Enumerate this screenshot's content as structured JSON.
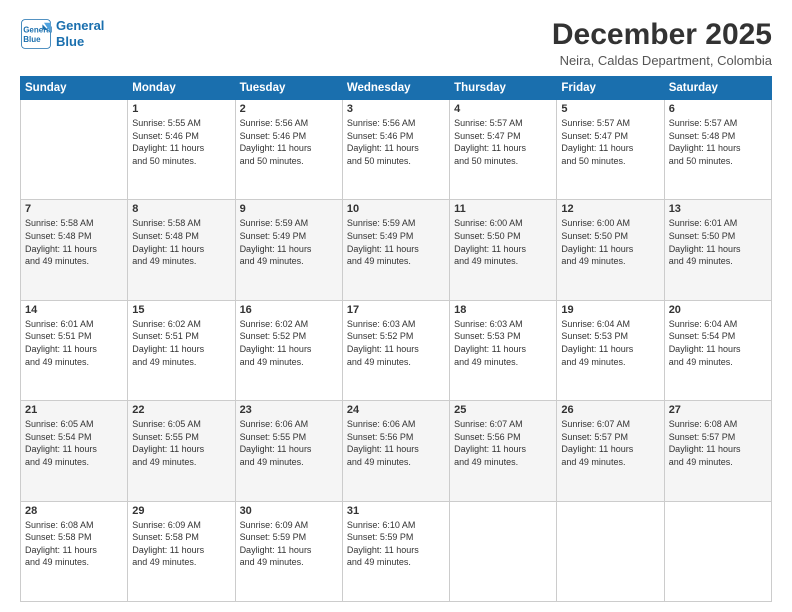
{
  "header": {
    "logo_line1": "General",
    "logo_line2": "Blue",
    "title": "December 2025",
    "subtitle": "Neira, Caldas Department, Colombia"
  },
  "days_of_week": [
    "Sunday",
    "Monday",
    "Tuesday",
    "Wednesday",
    "Thursday",
    "Friday",
    "Saturday"
  ],
  "weeks": [
    [
      {
        "day": "",
        "info": ""
      },
      {
        "day": "1",
        "info": "Sunrise: 5:55 AM\nSunset: 5:46 PM\nDaylight: 11 hours\nand 50 minutes."
      },
      {
        "day": "2",
        "info": "Sunrise: 5:56 AM\nSunset: 5:46 PM\nDaylight: 11 hours\nand 50 minutes."
      },
      {
        "day": "3",
        "info": "Sunrise: 5:56 AM\nSunset: 5:46 PM\nDaylight: 11 hours\nand 50 minutes."
      },
      {
        "day": "4",
        "info": "Sunrise: 5:57 AM\nSunset: 5:47 PM\nDaylight: 11 hours\nand 50 minutes."
      },
      {
        "day": "5",
        "info": "Sunrise: 5:57 AM\nSunset: 5:47 PM\nDaylight: 11 hours\nand 50 minutes."
      },
      {
        "day": "6",
        "info": "Sunrise: 5:57 AM\nSunset: 5:48 PM\nDaylight: 11 hours\nand 50 minutes."
      }
    ],
    [
      {
        "day": "7",
        "info": "Sunrise: 5:58 AM\nSunset: 5:48 PM\nDaylight: 11 hours\nand 49 minutes."
      },
      {
        "day": "8",
        "info": "Sunrise: 5:58 AM\nSunset: 5:48 PM\nDaylight: 11 hours\nand 49 minutes."
      },
      {
        "day": "9",
        "info": "Sunrise: 5:59 AM\nSunset: 5:49 PM\nDaylight: 11 hours\nand 49 minutes."
      },
      {
        "day": "10",
        "info": "Sunrise: 5:59 AM\nSunset: 5:49 PM\nDaylight: 11 hours\nand 49 minutes."
      },
      {
        "day": "11",
        "info": "Sunrise: 6:00 AM\nSunset: 5:50 PM\nDaylight: 11 hours\nand 49 minutes."
      },
      {
        "day": "12",
        "info": "Sunrise: 6:00 AM\nSunset: 5:50 PM\nDaylight: 11 hours\nand 49 minutes."
      },
      {
        "day": "13",
        "info": "Sunrise: 6:01 AM\nSunset: 5:50 PM\nDaylight: 11 hours\nand 49 minutes."
      }
    ],
    [
      {
        "day": "14",
        "info": "Sunrise: 6:01 AM\nSunset: 5:51 PM\nDaylight: 11 hours\nand 49 minutes."
      },
      {
        "day": "15",
        "info": "Sunrise: 6:02 AM\nSunset: 5:51 PM\nDaylight: 11 hours\nand 49 minutes."
      },
      {
        "day": "16",
        "info": "Sunrise: 6:02 AM\nSunset: 5:52 PM\nDaylight: 11 hours\nand 49 minutes."
      },
      {
        "day": "17",
        "info": "Sunrise: 6:03 AM\nSunset: 5:52 PM\nDaylight: 11 hours\nand 49 minutes."
      },
      {
        "day": "18",
        "info": "Sunrise: 6:03 AM\nSunset: 5:53 PM\nDaylight: 11 hours\nand 49 minutes."
      },
      {
        "day": "19",
        "info": "Sunrise: 6:04 AM\nSunset: 5:53 PM\nDaylight: 11 hours\nand 49 minutes."
      },
      {
        "day": "20",
        "info": "Sunrise: 6:04 AM\nSunset: 5:54 PM\nDaylight: 11 hours\nand 49 minutes."
      }
    ],
    [
      {
        "day": "21",
        "info": "Sunrise: 6:05 AM\nSunset: 5:54 PM\nDaylight: 11 hours\nand 49 minutes."
      },
      {
        "day": "22",
        "info": "Sunrise: 6:05 AM\nSunset: 5:55 PM\nDaylight: 11 hours\nand 49 minutes."
      },
      {
        "day": "23",
        "info": "Sunrise: 6:06 AM\nSunset: 5:55 PM\nDaylight: 11 hours\nand 49 minutes."
      },
      {
        "day": "24",
        "info": "Sunrise: 6:06 AM\nSunset: 5:56 PM\nDaylight: 11 hours\nand 49 minutes."
      },
      {
        "day": "25",
        "info": "Sunrise: 6:07 AM\nSunset: 5:56 PM\nDaylight: 11 hours\nand 49 minutes."
      },
      {
        "day": "26",
        "info": "Sunrise: 6:07 AM\nSunset: 5:57 PM\nDaylight: 11 hours\nand 49 minutes."
      },
      {
        "day": "27",
        "info": "Sunrise: 6:08 AM\nSunset: 5:57 PM\nDaylight: 11 hours\nand 49 minutes."
      }
    ],
    [
      {
        "day": "28",
        "info": "Sunrise: 6:08 AM\nSunset: 5:58 PM\nDaylight: 11 hours\nand 49 minutes."
      },
      {
        "day": "29",
        "info": "Sunrise: 6:09 AM\nSunset: 5:58 PM\nDaylight: 11 hours\nand 49 minutes."
      },
      {
        "day": "30",
        "info": "Sunrise: 6:09 AM\nSunset: 5:59 PM\nDaylight: 11 hours\nand 49 minutes."
      },
      {
        "day": "31",
        "info": "Sunrise: 6:10 AM\nSunset: 5:59 PM\nDaylight: 11 hours\nand 49 minutes."
      },
      {
        "day": "",
        "info": ""
      },
      {
        "day": "",
        "info": ""
      },
      {
        "day": "",
        "info": ""
      }
    ]
  ]
}
